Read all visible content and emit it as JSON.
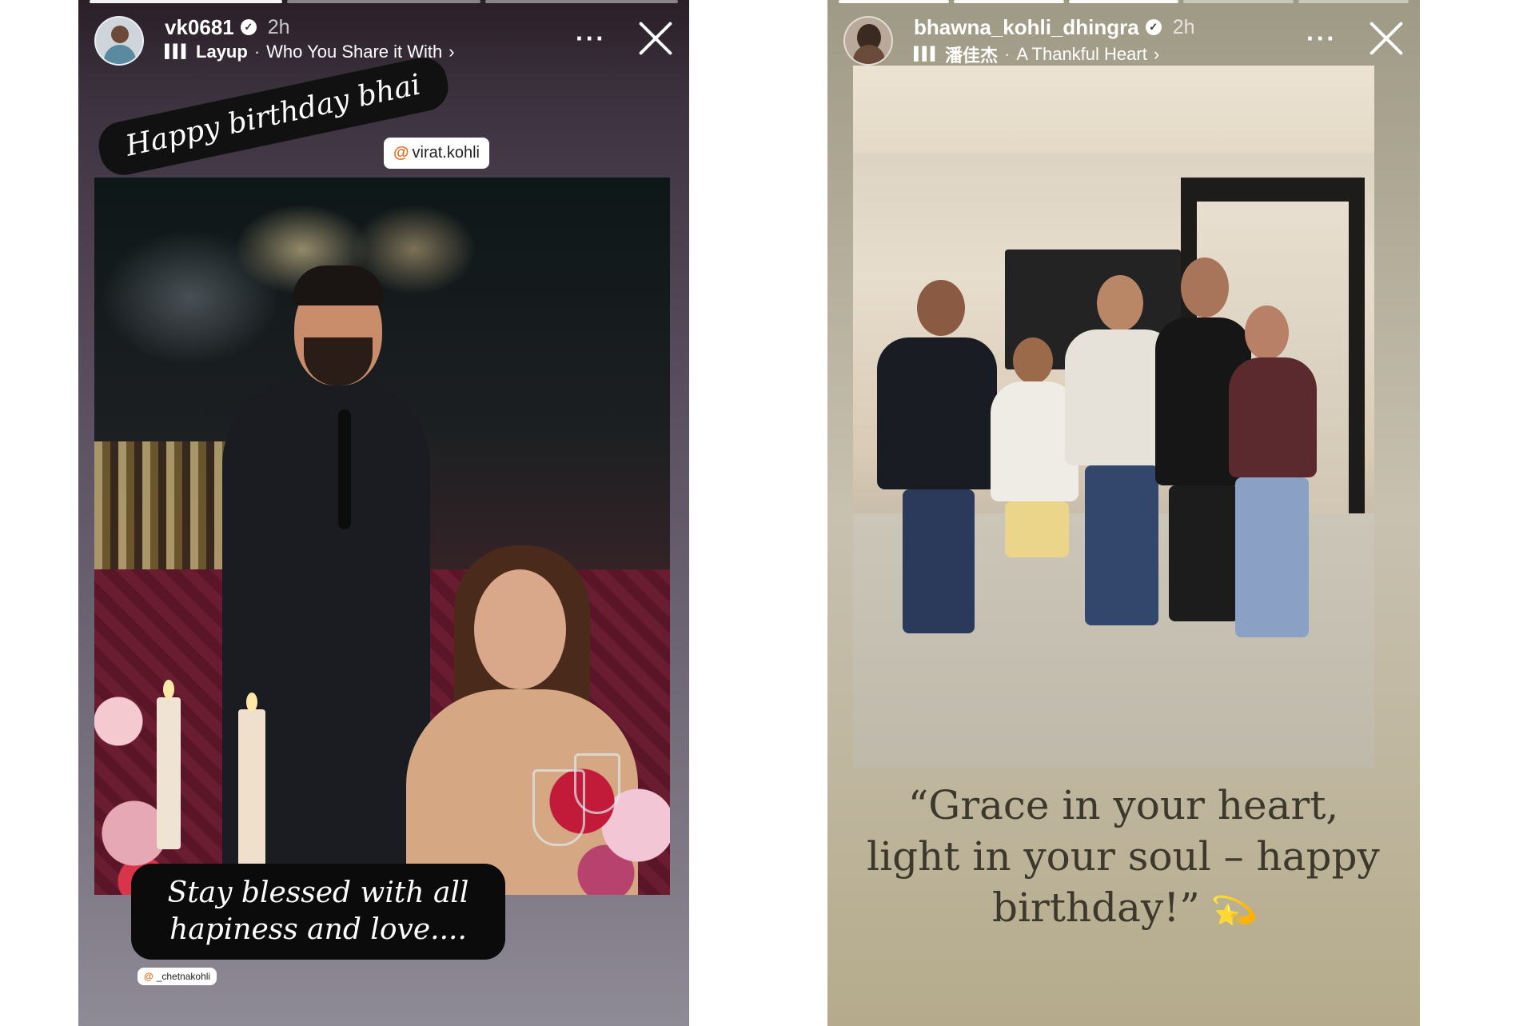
{
  "left_story": {
    "username": "vk0681",
    "time": "2h",
    "music_title": "Layup",
    "music_artist": "Who You Share it With",
    "sticker_top": "Happy birthday bhai",
    "mention_top": "virat.kohli",
    "sticker_bottom": "Stay blessed with all hapiness and love....",
    "mention_bottom": "_chetnakohli",
    "progress_segments": 3,
    "progress_done": 1
  },
  "right_story": {
    "username": "bhawna_kohli_dhingra",
    "time": "2h",
    "music_title": "潘佳杰",
    "music_artist": "A Thankful Heart",
    "quote": "“Grace in your heart, light in your soul – happy birthday!”",
    "progress_segments": 5,
    "progress_done": 3
  },
  "icons": {
    "verified": "verified-badge-icon",
    "music": "music-bars-icon",
    "more": "more-options-icon",
    "close": "close-icon",
    "mention": "at-mention-icon",
    "sparkle": "dizzy-sparkle-icon"
  },
  "colors": {
    "left_bg_top": "#2a1f27",
    "left_bg_bottom": "#8e8a96",
    "right_bg": "#c8c1b0",
    "mention_accent": "#e86b1c"
  }
}
